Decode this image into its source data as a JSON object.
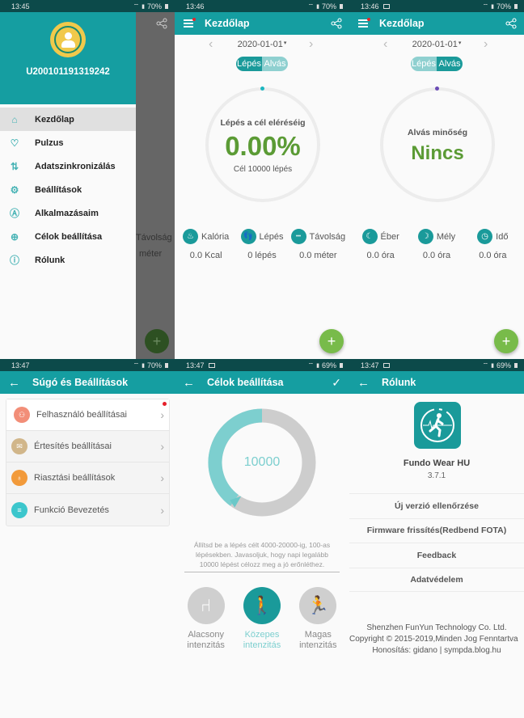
{
  "colors": {
    "primary": "#159ea1",
    "status_bar": "#0c4a4a",
    "accent_green": "#5b9b35",
    "fab_green": "#78bb4a",
    "teal_light": "#7dcfcf",
    "notification_red": "#e5252a"
  },
  "panel1": {
    "status": {
      "time": "13:45",
      "battery": "70%"
    },
    "user_id": "U200101191319242",
    "menu": [
      {
        "label": "Kezdőlap",
        "icon": "home-icon",
        "active": true
      },
      {
        "label": "Pulzus",
        "icon": "heart-icon"
      },
      {
        "label": "Adatszinkronizálás",
        "icon": "sync-icon"
      },
      {
        "label": "Beállítások",
        "icon": "gear-icon"
      },
      {
        "label": "Alkalmazásaim",
        "icon": "apps-icon"
      },
      {
        "label": "Célok beállítása",
        "icon": "target-icon"
      },
      {
        "label": "Rólunk",
        "icon": "info-icon"
      }
    ],
    "background_text": {
      "distance": "Távolság",
      "unit": "méter"
    }
  },
  "panel2": {
    "status": {
      "time": "13:46",
      "battery": "70%"
    },
    "title": "Kezdőlap",
    "date": "2020-01-01",
    "toggle": {
      "left": "Lépés",
      "right": "Alvás",
      "selected": "Lépés"
    },
    "ring": {
      "label": "Lépés a cél eléréséig",
      "value": "0.00%",
      "sub": "Cél 10000 lépés"
    },
    "stats": [
      {
        "icon": "fire-icon",
        "label": "Kalória",
        "value": "0.0 Kcal"
      },
      {
        "icon": "footprint-icon",
        "label": "Lépés",
        "value": "0 lépés"
      },
      {
        "icon": "ruler-icon",
        "label": "Távolság",
        "value": "0.0 méter"
      }
    ]
  },
  "panel3": {
    "status": {
      "time": "13:46",
      "battery": "70%"
    },
    "title": "Kezdőlap",
    "date": "2020-01-01",
    "toggle": {
      "left": "Lépés",
      "right": "Alvás",
      "selected": "Alvás"
    },
    "ring": {
      "label": "Alvás minőség",
      "value": "Nincs"
    },
    "stats": [
      {
        "icon": "moon-icon",
        "label": "Éber",
        "value": "0.0 óra"
      },
      {
        "icon": "deep-sleep-icon",
        "label": "Mély",
        "value": "0.0 óra"
      },
      {
        "icon": "clock-icon",
        "label": "Idő",
        "value": "0.0 óra"
      }
    ]
  },
  "panel4": {
    "status": {
      "time": "13:47",
      "battery": "70%"
    },
    "title": "Súgó és Beállítások",
    "items": [
      {
        "label": "Felhasználó beállításai",
        "icon": "user-icon",
        "color": "#f28e78",
        "badge": true
      },
      {
        "label": "Értesítés beállításai",
        "icon": "mail-icon",
        "color": "#d1b68a"
      },
      {
        "label": "Riasztási beállítások",
        "icon": "bulb-icon",
        "color": "#f29a3a"
      },
      {
        "label": "Funkció Bevezetés",
        "icon": "list-icon",
        "color": "#3cc6cc"
      }
    ]
  },
  "panel5": {
    "status": {
      "time": "13:47",
      "battery": "69%"
    },
    "title": "Célok beállítása",
    "goal_value": "10000",
    "goal_fraction": 0.4,
    "description": "Állítsd be a lépés célt 4000-20000-ig, 100-as lépésekben. Javasoljuk, hogy napi legalább 10000 lépést célozz meg a jó erőnléthez.",
    "intensity": [
      {
        "label1": "Alacsony",
        "label2": "intenzitás",
        "icon": "sitting-icon"
      },
      {
        "label1": "Közepes",
        "label2": "intenzitás",
        "icon": "walking-icon",
        "selected": true
      },
      {
        "label1": "Magas",
        "label2": "intenzitás",
        "icon": "running-icon"
      }
    ]
  },
  "panel6": {
    "status": {
      "time": "13:47",
      "battery": "69%"
    },
    "title": "Rólunk",
    "app_name": "Fundo Wear HU",
    "version": "3.7.1",
    "options": [
      "Új verzió ellenőrzése",
      "Firmware frissítés(Redbend FOTA)",
      "Feedback",
      "Adatvédelem"
    ],
    "company": "Shenzhen FunYun Technology Co. Ltd.",
    "copyright": "Copyright © 2015-2019,Minden Jog Fenntartva",
    "localization": "Honosítás: gidano | sympda.blog.hu"
  }
}
